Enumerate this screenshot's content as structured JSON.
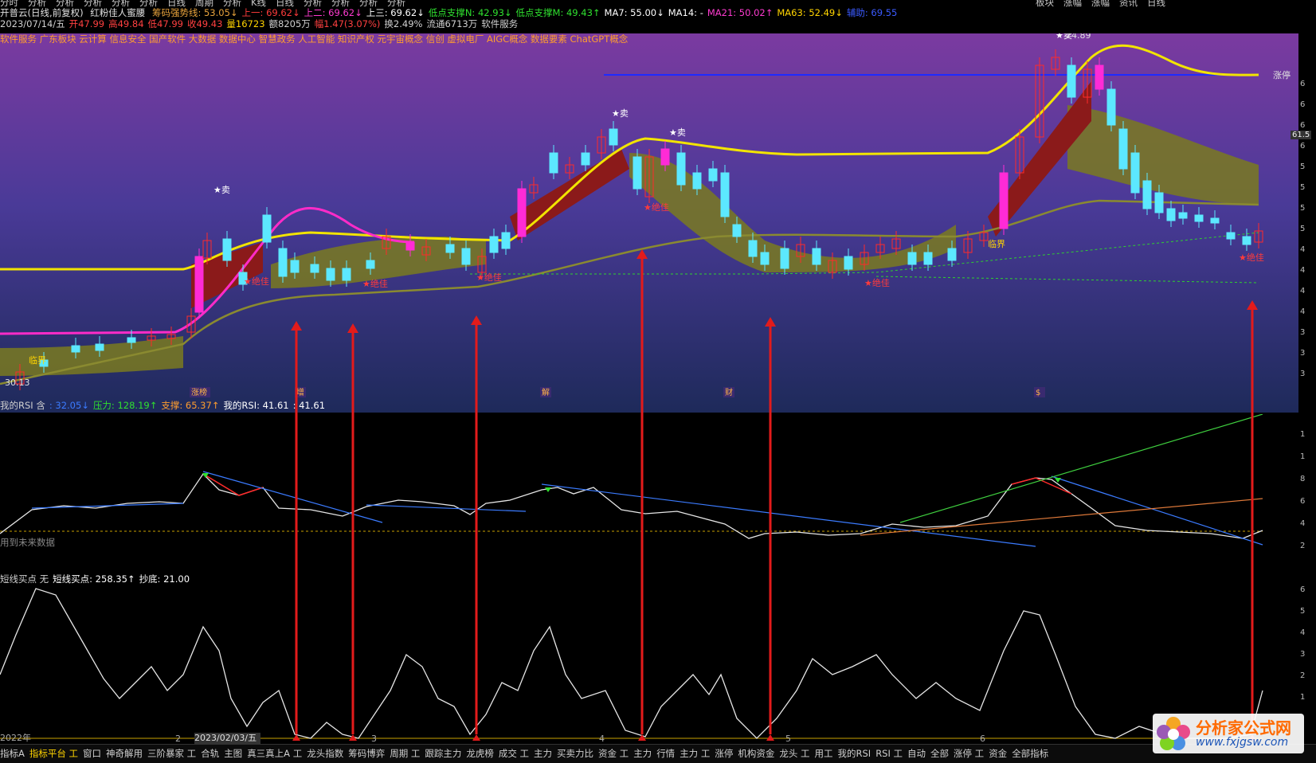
{
  "menu": {
    "items": [
      "分时",
      "分析",
      "分析",
      "分析",
      "分析",
      "分析",
      "日线",
      "周期",
      "分析",
      "K线",
      "日线",
      "分析",
      "分析",
      "分析",
      "分析"
    ],
    "right_items": [
      "板块",
      "涨幅",
      "涨幅",
      "资讯",
      "日线"
    ]
  },
  "header": {
    "stock": "开普云(日线,前复权)",
    "indicator_name": "红粉佳人蜜腰",
    "line1": [
      {
        "t": "筹码强势线: 53.05↓",
        "c": "#e8a33c"
      },
      {
        "t": "上一: 69.62↓",
        "c": "#ff3b3b"
      },
      {
        "t": "上二: 69.62↓",
        "c": "#ff3bd0"
      },
      {
        "t": "上三: 69.62↓",
        "c": "#ffffff"
      },
      {
        "t": "低点支撑N: 42.93↓",
        "c": "#2fe02f"
      },
      {
        "t": "低点支撑M: 49.43↑",
        "c": "#2fe02f"
      },
      {
        "t": "MA7: 55.00↓",
        "c": "#ffffff"
      },
      {
        "t": "MA14: -",
        "c": "#ffffff"
      },
      {
        "t": "MA21: 50.02↑",
        "c": "#ff3bd0"
      },
      {
        "t": "MA63: 52.49↓",
        "c": "#ffd400"
      },
      {
        "t": "辅助: 69.55",
        "c": "#3b5bff"
      }
    ],
    "line2": [
      {
        "t": "2023/07/14/五",
        "c": "#d0d0d0"
      },
      {
        "t": "开47.99",
        "c": "#ff4040"
      },
      {
        "t": "高49.84",
        "c": "#ff4040"
      },
      {
        "t": "低47.99",
        "c": "#ff4040"
      },
      {
        "t": "收49.43",
        "c": "#ff4040"
      },
      {
        "t": "量16723",
        "c": "#ffd400"
      },
      {
        "t": "额8205万",
        "c": "#d0d0d0"
      },
      {
        "t": "幅1.47(3.07%)",
        "c": "#ff4040"
      },
      {
        "t": "换2.49%",
        "c": "#d0d0d0"
      },
      {
        "t": "流通6713万",
        "c": "#d0d0d0"
      },
      {
        "t": "软件服务",
        "c": "#d0d0d0"
      }
    ]
  },
  "sectors": "软件服务 广东板块 云计算 信息安全 国产软件 大数据 数据中心 智慧政务 人工智能 知识产权 元宇宙概念 信创 虚拟电厂 AIGC概念 数据要素 ChatGPT概念",
  "main_chart": {
    "max_price_label": "74.89",
    "min_price_label": "30.13",
    "limit_label": "涨停",
    "critical_label": "临界",
    "sell_label": "★卖",
    "best_label": "★绝佳",
    "event_tags": [
      "涨榜",
      "增",
      "解",
      "财",
      "$"
    ],
    "right_scale": [
      "6",
      "6",
      "6",
      "6",
      "5",
      "5",
      "5",
      "5",
      "4",
      "4",
      "4",
      "4",
      "3",
      "3",
      "3"
    ],
    "price_tag": "61.5"
  },
  "rsi_panel": {
    "legend": [
      {
        "t": "我的RSI 含",
        "c": "#d0d0d0"
      },
      {
        "t": ": 32.05↓",
        "c": "#3b7bff"
      },
      {
        "t": "压力: 128.19↑",
        "c": "#2fe02f"
      },
      {
        "t": "支撑: 65.37↑",
        "c": "#ff9d2e"
      },
      {
        "t": "我的RSI: 41.61",
        "c": "#ffffff"
      },
      {
        "t": ": 41.61",
        "c": "#ffffff"
      }
    ],
    "note": "用到未来数据",
    "right_scale": [
      "1",
      "1",
      "8",
      "6",
      "4",
      "2"
    ]
  },
  "short_panel": {
    "legend": [
      {
        "t": "短线买点 无",
        "c": "#d0d0d0"
      },
      {
        "t": "短线买点: 258.35↑",
        "c": "#ffffff"
      },
      {
        "t": "抄底: 21.00",
        "c": "#ffffff"
      }
    ],
    "right_scale": [
      "6",
      "5",
      "4",
      "3",
      "2",
      "1"
    ]
  },
  "x_axis": {
    "year": "2022年",
    "date": "2023/02/03/五",
    "months": [
      "2",
      "3",
      "4",
      "5",
      "6"
    ]
  },
  "bottom_bar": {
    "items": [
      "指标A",
      "指标平台",
      "窗口",
      "神奇解用",
      "三阶暴家",
      "合轨",
      "主图",
      "真三真上A",
      "龙头指数",
      "筹码博弈",
      "周期",
      "跟踪主力",
      "龙虎榜",
      "成交",
      "主力",
      "买卖力比",
      "资金",
      "主力",
      "行情",
      "主力",
      "涨停",
      "机构资金",
      "龙头",
      "用工",
      "我的RSI",
      "RSI",
      "自动",
      "全部",
      "涨停",
      "资金",
      "全部指标"
    ],
    "active_index": 1
  },
  "watermark": {
    "title": "分析家公式网",
    "url": "www.fxjgsw.com"
  }
}
